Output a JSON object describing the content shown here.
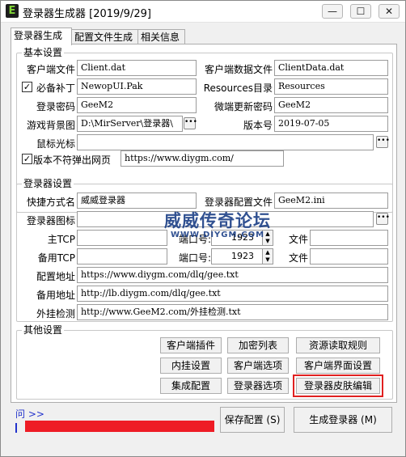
{
  "window": {
    "title": "登录器生成器 [2019/9/29]",
    "app_icon_letter": "E",
    "controls": {
      "minimize": "—",
      "maximize": "☐",
      "close": "✕"
    }
  },
  "tabs": [
    {
      "label": "登录器生成",
      "active": true
    },
    {
      "label": "配置文件生成",
      "active": false
    },
    {
      "label": "相关信息",
      "active": false
    }
  ],
  "basic": {
    "title": "基本设置",
    "client_file_label": "客户端文件",
    "client_file_value": "Client.dat",
    "client_data_label": "客户端数据文件",
    "client_data_value": "ClientData.dat",
    "patch_label": "必备补丁",
    "patch_checked": true,
    "patch_value": "NewopUI.Pak",
    "resources_label": "Resources目录",
    "resources_value": "Resources",
    "login_pwd_label": "登录密码",
    "login_pwd_value": "GeeM2",
    "update_pwd_label": "微端更新密码",
    "update_pwd_value": "GeeM2",
    "bg_label": "游戏背景图",
    "bg_value": "D:\\MirServer\\登录器\\",
    "version_label": "版本号",
    "version_value": "2019-07-05",
    "cursor_label": "鼠标光标",
    "cursor_value": "",
    "popup_label": "版本不符弹出网页",
    "popup_checked": true,
    "popup_value": "https://www.diygm.com/"
  },
  "launcher": {
    "title": "登录器设置",
    "shortcut_label": "快捷方式名",
    "shortcut_value": "威威登录器",
    "config_label": "登录器配置文件",
    "config_value": "GeeM2.ini",
    "icon_label": "登录器图标",
    "icon_value": "",
    "main_tcp_label": "主TCP",
    "main_tcp_value": "",
    "port_label": "端口号:",
    "main_port_value": "1923",
    "file_label": "文件",
    "main_file_value": "",
    "backup_tcp_label": "备用TCP",
    "backup_tcp_value": "",
    "backup_port_value": "1923",
    "backup_file_value": "",
    "config_addr_label": "配置地址",
    "config_addr_value": "https://www.diygm.com/dlq/gee.txt",
    "backup_addr_label": "备用地址",
    "backup_addr_value": "http://lb.diygm.com/dlq/gee.txt",
    "plugin_check_label": "外挂检测",
    "plugin_check_value": "http://www.GeeM2.com/外挂检测.txt"
  },
  "other": {
    "title": "其他设置",
    "buttons": {
      "client_plugin": "客户端插件",
      "encrypt_list": "加密列表",
      "resource_rules": "资源读取规则",
      "inline_settings": "内挂设置",
      "client_options": "客户端选项",
      "client_ui_settings": "客户端界面设置",
      "integrated_config": "集成配置",
      "launcher_options": "登录器选项",
      "skin_editor": "登录器皮肤编辑"
    }
  },
  "footer": {
    "link_text": "问 >>",
    "save_config": "保存配置 (S)",
    "generate_launcher": "生成登录器 (M)"
  },
  "watermark": {
    "title": "威威传奇论坛",
    "url": "WWW.DIYGM.COM"
  },
  "colors": {
    "highlight": "#e02020",
    "redaction": "#ee1c25",
    "watermark": "#1b3f86",
    "link": "#2233cc"
  }
}
